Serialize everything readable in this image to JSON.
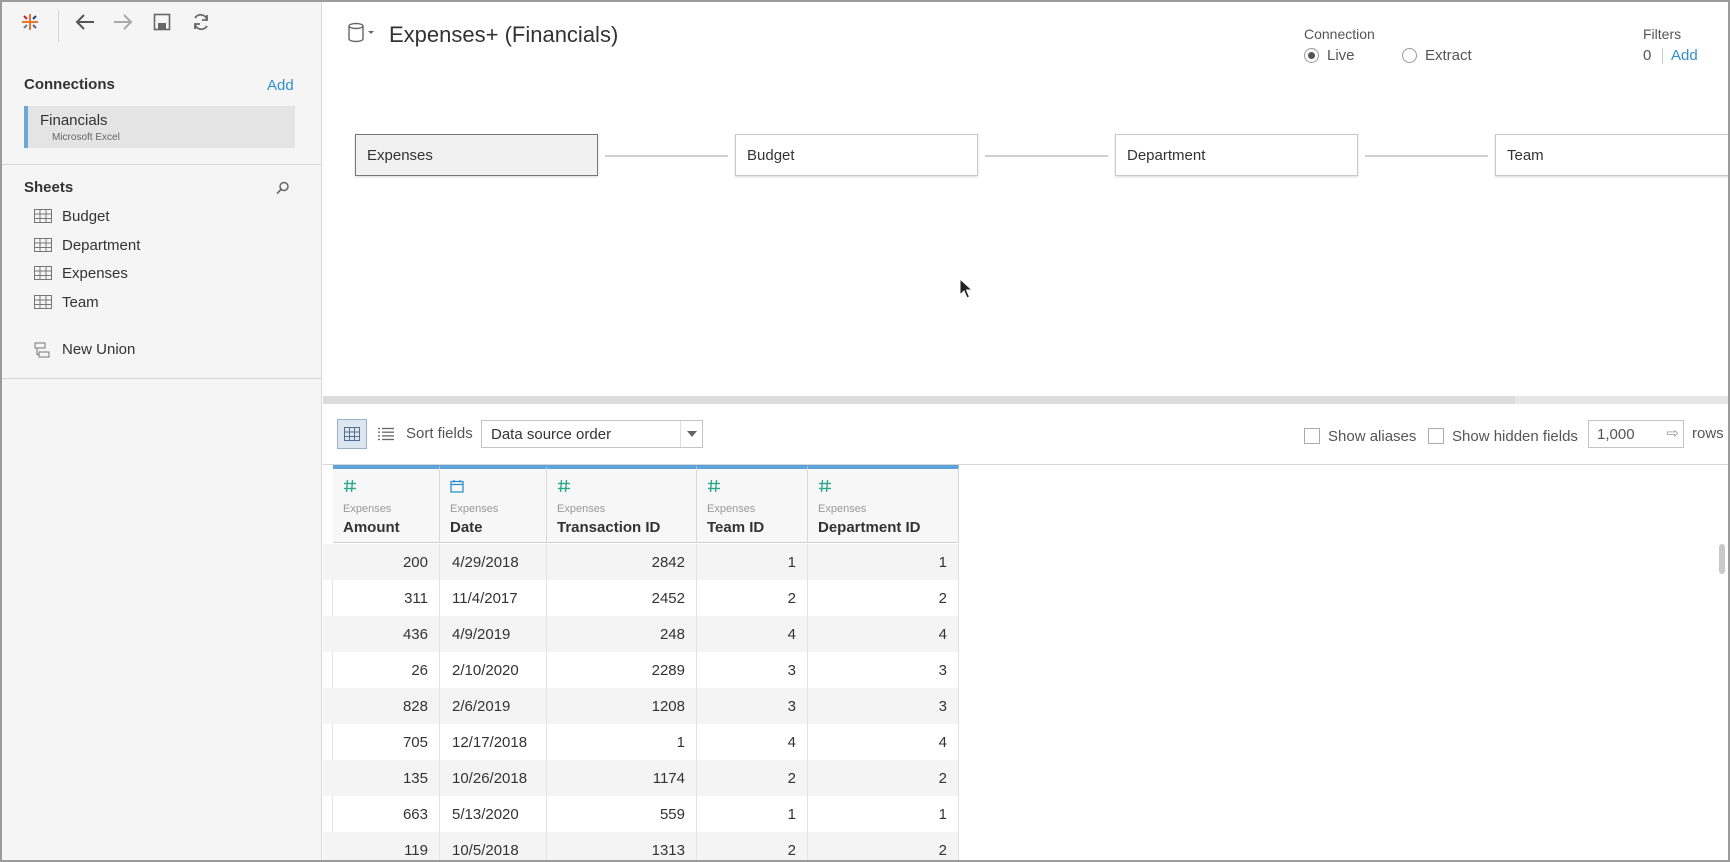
{
  "left_pane": {
    "connections_title": "Connections",
    "connections_add": "Add",
    "connection": {
      "name": "Financials",
      "type": "Microsoft Excel"
    },
    "sheets_title": "Sheets",
    "sheets": [
      "Budget",
      "Department",
      "Expenses",
      "Team"
    ],
    "new_union": "New Union"
  },
  "header": {
    "datasource_title": "Expenses+ (Financials)",
    "connection_label": "Connection",
    "live_label": "Live",
    "extract_label": "Extract",
    "connection_mode": "Live",
    "filters_label": "Filters",
    "filters_count": "0",
    "filters_add": "Add"
  },
  "canvas": {
    "tables": [
      "Expenses",
      "Budget",
      "Department",
      "Team"
    ]
  },
  "grid_toolbar": {
    "sort_label": "Sort fields",
    "sort_value": "Data source order",
    "show_aliases": "Show aliases",
    "show_hidden": "Show hidden fields",
    "rows_value": "1,000",
    "rows_label": "rows"
  },
  "grid": {
    "columns": [
      {
        "source": "Expenses",
        "name": "Amount",
        "type": "number"
      },
      {
        "source": "Expenses",
        "name": "Date",
        "type": "date"
      },
      {
        "source": "Expenses",
        "name": "Transaction ID",
        "type": "number"
      },
      {
        "source": "Expenses",
        "name": "Team ID",
        "type": "number"
      },
      {
        "source": "Expenses",
        "name": "Department ID",
        "type": "number"
      }
    ],
    "rows": [
      [
        "200",
        "4/29/2018",
        "2842",
        "1",
        "1"
      ],
      [
        "311",
        "11/4/2017",
        "2452",
        "2",
        "2"
      ],
      [
        "436",
        "4/9/2019",
        "248",
        "4",
        "4"
      ],
      [
        "26",
        "2/10/2020",
        "2289",
        "3",
        "3"
      ],
      [
        "828",
        "2/6/2019",
        "1208",
        "3",
        "3"
      ],
      [
        "705",
        "12/17/2018",
        "1",
        "4",
        "4"
      ],
      [
        "135",
        "10/26/2018",
        "1174",
        "2",
        "2"
      ],
      [
        "663",
        "5/13/2020",
        "559",
        "1",
        "1"
      ],
      [
        "119",
        "10/5/2018",
        "1313",
        "2",
        "2"
      ]
    ]
  },
  "colors": {
    "accent": "#2f8fcf",
    "header_accent": "#5ea3d9",
    "number_icon": "#2aa88a",
    "date_icon": "#2f8fcf"
  }
}
